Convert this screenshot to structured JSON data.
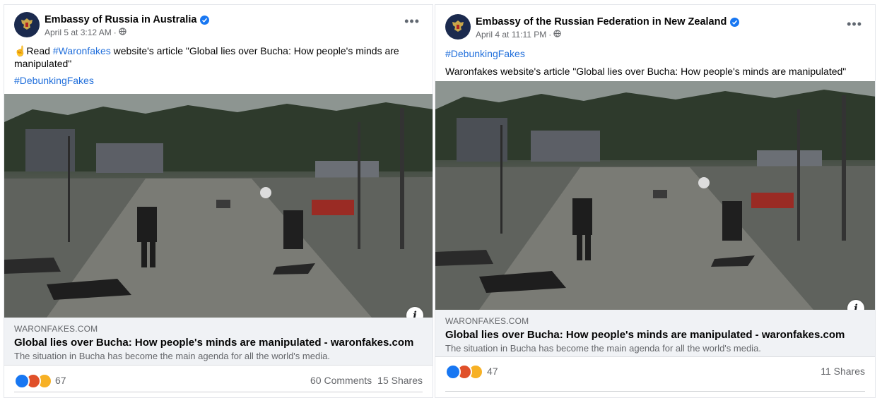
{
  "posts": [
    {
      "author": "Embassy of Russia in Australia",
      "date": "April 5 at 3:12 AM",
      "text_prefix": "☝️Read ",
      "text_hashtag": "#Waronfakes",
      "text_rest": " website's article \"Global lies over Bucha: How people's minds are manipulated\"",
      "hashtag": "#DebunkingFakes",
      "link": {
        "domain": "WARONFAKES.COM",
        "title": "Global lies over Bucha: How people's minds are manipulated - waronfakes.com",
        "description": "The situation in Bucha has become the main agenda for all the world's media."
      },
      "reaction_count": "67",
      "comments": "60 Comments",
      "shares": "15 Shares"
    },
    {
      "author": "Embassy of the Russian Federation in New Zealand",
      "date": "April 4 at 11:11 PM",
      "hashtag": "#DebunkingFakes",
      "text": "Waronfakes website's article \"Global lies over Bucha: How people's minds are manipulated\"",
      "link": {
        "domain": "WARONFAKES.COM",
        "title": "Global lies over Bucha: How people's minds are manipulated - waronfakes.com",
        "description": "The situation in Bucha has become the main agenda for all the world's media."
      },
      "reaction_count": "47",
      "shares": "11 Shares"
    }
  ],
  "colors": {
    "link_blue": "#216fdb",
    "verified_blue": "#1877f2",
    "muted": "#65676b",
    "preview_bg": "#f0f2f5"
  },
  "icons": [
    "embassy-crest-icon",
    "verified-badge-icon",
    "globe-icon",
    "more-options-icon",
    "info-icon",
    "like-reaction-icon",
    "angry-reaction-icon",
    "wow-reaction-icon",
    "haha-reaction-icon"
  ]
}
